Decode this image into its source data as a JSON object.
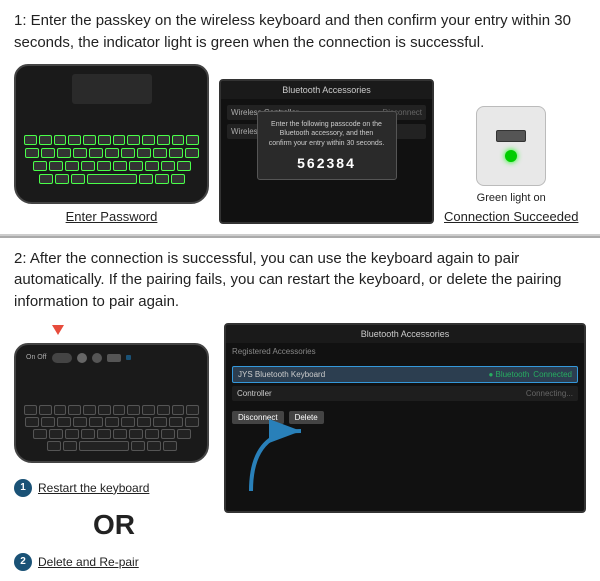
{
  "section1": {
    "header": "1: Enter the passkey on the wireless keyboard and then confirm your entry within 30 seconds, the  indicator light is green when the connection is successful.",
    "keyboard_caption": "Enter Password",
    "connection_caption": "Connection Succeeded",
    "green_light_label": "Green light on",
    "passcode": "562384",
    "dialog_text": "Enter the following passcode on the Bluetooth accessory, and then confirm your entry within 30 seconds.",
    "tv_title": "Bluetooth Accessories",
    "list_items": [
      {
        "label": "Wireless Controller",
        "status": "●  Disconnect"
      },
      {
        "label": "Wireless",
        "status": ""
      }
    ]
  },
  "section2": {
    "header": "2: After the connection is successful, you can use the keyboard again to pair automatically. If the pairing fails, you can restart the keyboard, or delete the pairing information to pair again.",
    "step1_label": "Restart the keyboard",
    "or_text": "OR",
    "step2_label": "Delete and Re-pair",
    "tv_title": "Bluetooth Accessories",
    "tv_items": [
      {
        "name": "JYS Bluetooth Keyboard",
        "status": "● Bluetooth",
        "status2": "Connected"
      },
      {
        "name": "Controller",
        "status": "",
        "status2": "Connecting..."
      }
    ],
    "tv_buttons": [
      "Disconnect",
      "Delete"
    ],
    "registered_label": "Registered Accessories"
  }
}
